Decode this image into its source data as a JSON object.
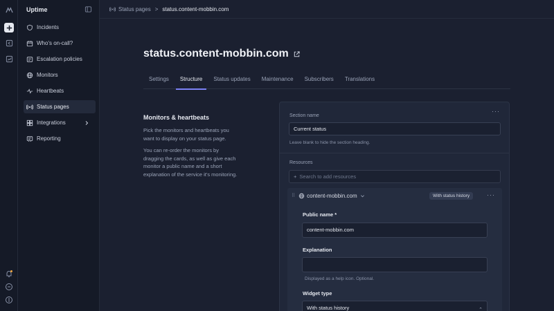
{
  "app": {
    "name": "Uptime"
  },
  "sidebar": {
    "items": [
      {
        "label": "Incidents",
        "icon": "shield-icon"
      },
      {
        "label": "Who's on-call?",
        "icon": "calendar-icon"
      },
      {
        "label": "Escalation policies",
        "icon": "escalation-icon"
      },
      {
        "label": "Monitors",
        "icon": "globe-icon"
      },
      {
        "label": "Heartbeats",
        "icon": "pulse-icon"
      },
      {
        "label": "Status pages",
        "icon": "broadcast-icon",
        "active": true
      },
      {
        "label": "Integrations",
        "icon": "puzzle-icon"
      },
      {
        "label": "Reporting",
        "icon": "report-icon"
      }
    ]
  },
  "breadcrumb": {
    "parent": "Status pages",
    "separator": ">",
    "current": "status.content-mobbin.com"
  },
  "page": {
    "title": "status.content-mobbin.com"
  },
  "tabs": [
    "Settings",
    "Structure",
    "Status updates",
    "Maintenance",
    "Subscribers",
    "Translations"
  ],
  "active_tab": "Structure",
  "section": {
    "title": "Monitors & heartbeats",
    "description1": "Pick the monitors and heartbeats you want to display on your status page.",
    "description2": "You can re-order the monitors by dragging the cards, as well as give each monitor a public name and a short explanation of the service it's monitoring."
  },
  "card": {
    "more": "···",
    "section_name_label": "Section name",
    "section_name_value": "Current status",
    "section_name_hint": "Leave blank to hide the section heading.",
    "resources_label": "Resources",
    "search_placeholder": "Search to add resources",
    "resource": {
      "name": "content-mobbin.com",
      "badge": "With status history",
      "public_name_label": "Public name *",
      "public_name_value": "content-mobbin.com",
      "explanation_label": "Explanation",
      "explanation_value": "",
      "explanation_hint": "Displayed as a help icon. Optional.",
      "widget_type_label": "Widget type",
      "widget_type_value": "With status history"
    }
  },
  "colors": {
    "accent": "#7c82f5",
    "background": "#1b2030",
    "sidebar": "#151a27"
  }
}
